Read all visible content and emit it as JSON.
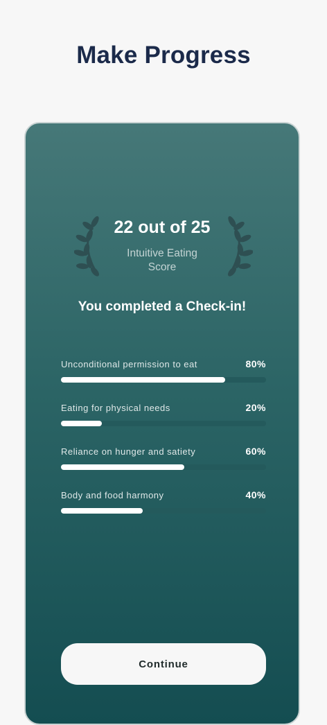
{
  "header": {
    "title": "Make Progress"
  },
  "score": {
    "value_text": "22 out of 25",
    "caption_line1": "Intuitive Eating",
    "caption_line2": "Score"
  },
  "completed_message": "You completed a Check-in!",
  "metrics": [
    {
      "label": "Unconditional permission to eat",
      "percent_text": "80%",
      "percent": 80
    },
    {
      "label": "Eating for physical needs",
      "percent_text": "20%",
      "percent": 20
    },
    {
      "label": "Reliance on hunger and satiety",
      "percent_text": "60%",
      "percent": 60
    },
    {
      "label": "Body and food harmony",
      "percent_text": "40%",
      "percent": 40
    }
  ],
  "actions": {
    "continue_label": "Continue"
  },
  "icons": {
    "left_decoration": "laurel-branch-left-icon",
    "right_decoration": "laurel-branch-right-icon"
  },
  "colors": {
    "title": "#1b2a4a",
    "card_top": "#467878",
    "card_bottom": "#144d51",
    "laurel": "#2e4f52",
    "bar_fill": "#ffffff",
    "bar_track": "#245a5c"
  }
}
